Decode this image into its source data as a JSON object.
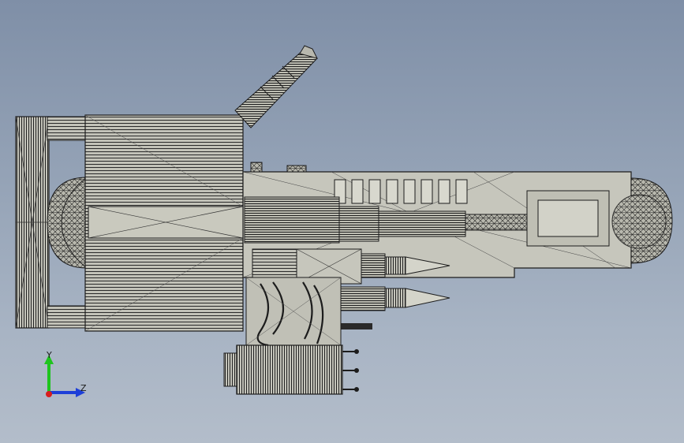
{
  "viewport": {
    "background_top": "#7f8fa7",
    "background_bottom": "#b3bdca",
    "model_fill": "#c6c6bc",
    "edge_color": "#1c1c1c"
  },
  "model": {
    "icon": "cad-assembly-wireframe"
  },
  "triad": {
    "y_label": "Y",
    "z_label": "Z",
    "y_color": "#1ec41e",
    "z_color": "#1d3fd8",
    "x_color": "#d81d1d"
  }
}
